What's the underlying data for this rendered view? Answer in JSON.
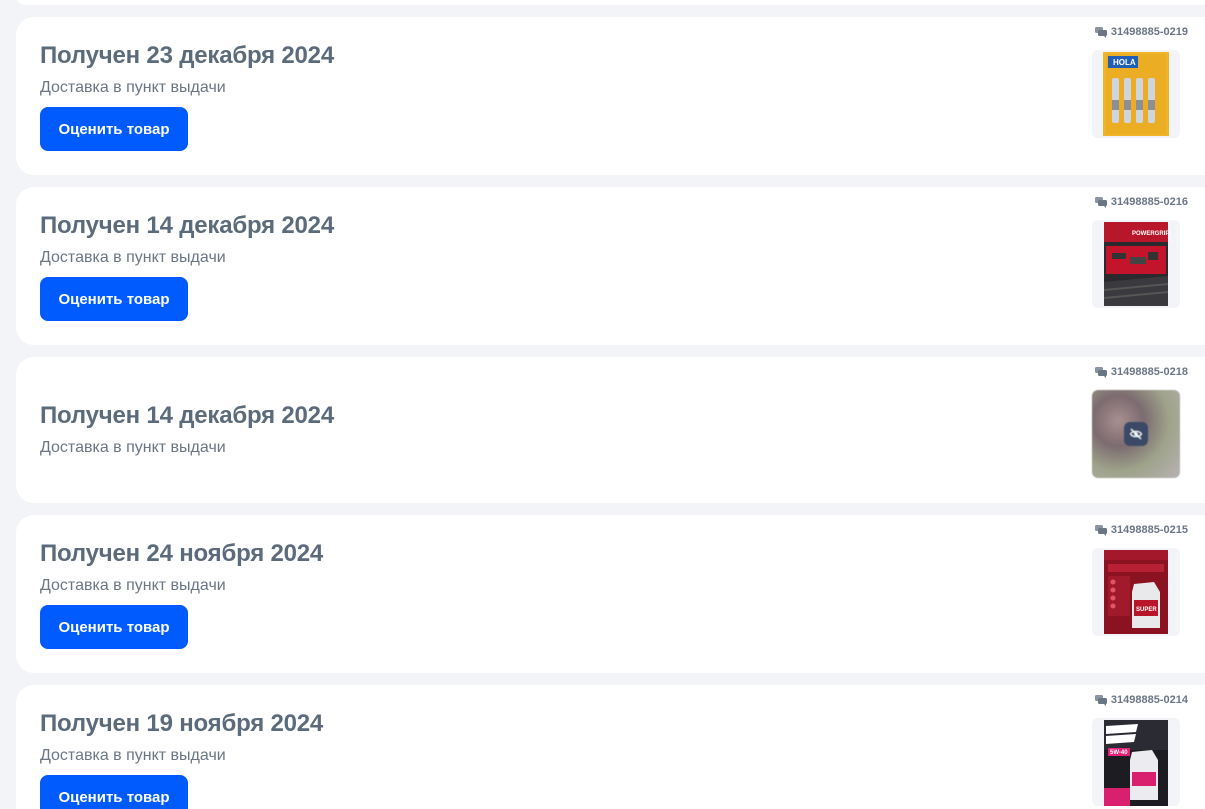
{
  "orders": [
    {
      "title": "Получен 23 декабря 2024",
      "subtitle": "Доставка в пункт выдачи",
      "button_label": "Оценить товар",
      "order_id": "31498885-0219",
      "product_image": "spark-plugs-hola"
    },
    {
      "title": "Получен 14 декабря 2024",
      "subtitle": "Доставка в пункт выдачи",
      "button_label": "Оценить товар",
      "order_id": "31498885-0216",
      "product_image": "powergrip-belt"
    },
    {
      "title": "Получен 14 декабря 2024",
      "subtitle": "Доставка в пункт выдачи",
      "order_id": "31498885-0218",
      "product_image": "hidden-blurred-image"
    },
    {
      "title": "Получен 24 ноября 2024",
      "subtitle": "Доставка в пункт выдачи",
      "button_label": "Оценить товар",
      "order_id": "31498885-0215",
      "product_image": "lukoil-super-oil"
    },
    {
      "title": "Получен 19 ноября 2024",
      "subtitle": "Доставка в пункт выдачи",
      "button_label": "Оценить товар",
      "order_id": "31498885-0214",
      "product_image": "krepkoe-maslo-5w-40"
    }
  ],
  "colors": {
    "background": "#f2f4f8",
    "card": "#ffffff",
    "accent": "#005bff",
    "title": "#5c6b7c",
    "muted": "#6b7685"
  }
}
